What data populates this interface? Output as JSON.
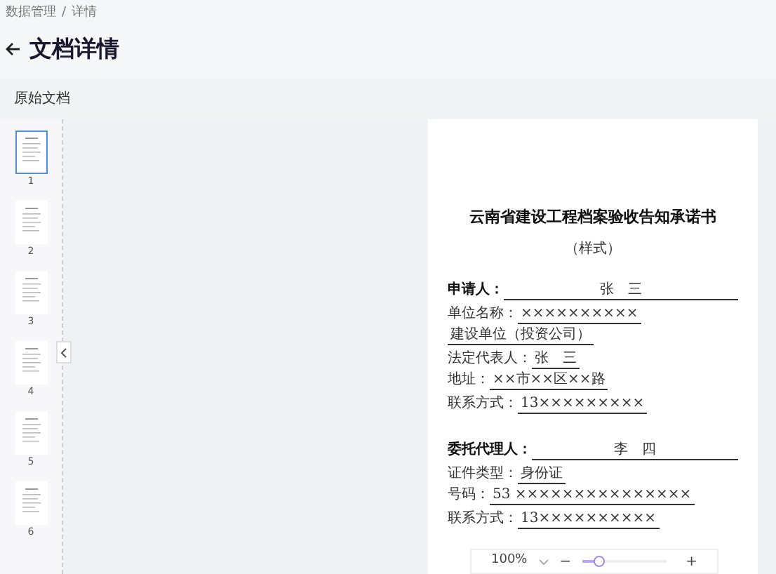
{
  "breadcrumb": [
    {
      "label": "数据管理"
    },
    {
      "label": "详情"
    }
  ],
  "breadcrumb_separator": "/",
  "title": "文档详情",
  "card_title": "原始文档",
  "thumbnails": [
    {
      "label": "1",
      "selected": true
    },
    {
      "label": "2",
      "selected": false
    },
    {
      "label": "3",
      "selected": false
    },
    {
      "label": "4",
      "selected": false
    },
    {
      "label": "5",
      "selected": false
    },
    {
      "label": "6",
      "selected": false
    }
  ],
  "document": {
    "title": "云南省建设工程档案验收告知承诺书",
    "subtitle": "（样式）",
    "sections": [
      {
        "rows": [
          [
            {
              "label": "申请人：",
              "value": "张　三",
              "bold": true,
              "kind": "wide"
            }
          ],
          [
            {
              "label": "单位名称：",
              "value": "××××××××××",
              "bold": false,
              "kind": "short"
            },
            {
              "value": "建设单位（投资公司）",
              "kind": "short"
            }
          ],
          [
            {
              "label": "法定代表人：",
              "value": "张　三",
              "bold": false,
              "kind": "short"
            },
            {
              "label": "地址：",
              "value": "××市××区××路",
              "bold": false,
              "kind": "short"
            }
          ],
          [
            {
              "label": "联系方式：",
              "value": "13×××××××××",
              "bold": false,
              "kind": "short"
            }
          ]
        ]
      },
      {
        "rows": [
          [
            {
              "label": "委托代理人：",
              "value": "李　四",
              "bold": true,
              "kind": "wide"
            }
          ],
          [
            {
              "label": "证件类型：",
              "value": "身份证",
              "bold": false,
              "kind": "short"
            },
            {
              "label": "号码：",
              "value": "53 ×××××××××××××××",
              "bold": false,
              "kind": "short"
            }
          ],
          [
            {
              "label": "联系方式：",
              "value": "13××××××××××",
              "bold": false,
              "kind": "short"
            }
          ]
        ]
      }
    ]
  },
  "zoom": {
    "value": "100%",
    "minus": "−",
    "plus": "+",
    "level": 0.2
  }
}
